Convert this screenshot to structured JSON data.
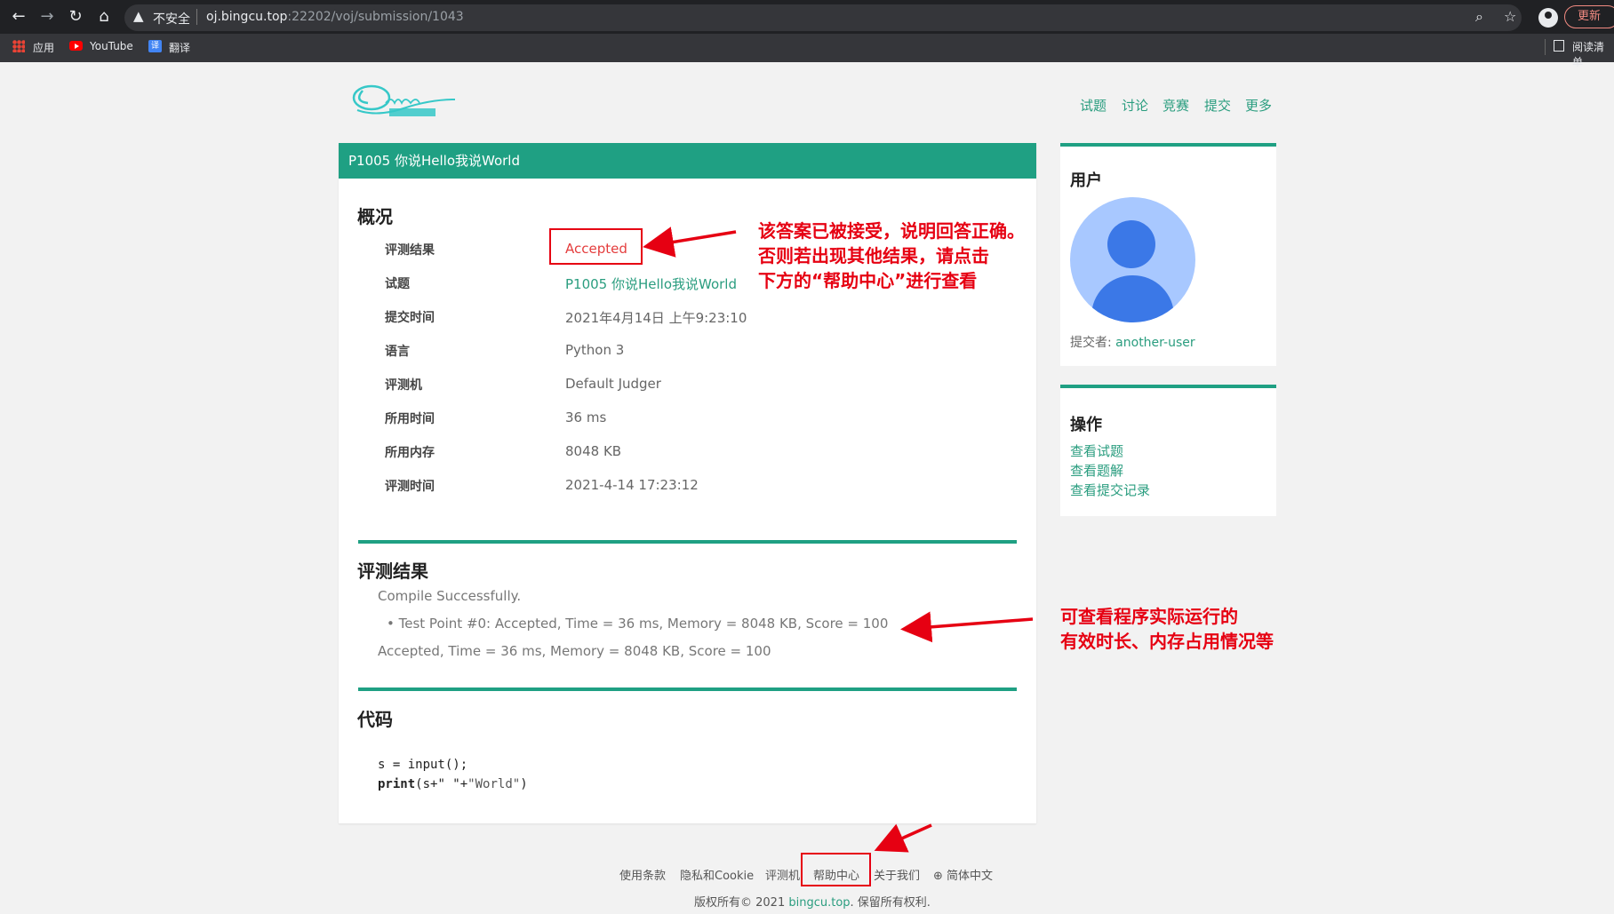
{
  "browser": {
    "insecure_label": "不安全",
    "url_host": "oj.bingcu.top",
    "url_rest": ":22202/voj/submission/1043",
    "update_label": "更新",
    "bookmarks": {
      "apps": "应用",
      "youtube": "YouTube",
      "translate": "翻译"
    },
    "reading_list": "阅读清单"
  },
  "site": {
    "nav": [
      "试题",
      "讨论",
      "竞赛",
      "提交",
      "更多"
    ]
  },
  "problem_header": "P1005 你说Hello我说World",
  "overview": {
    "title": "概况",
    "rows": [
      {
        "label": "评测结果",
        "value": "Accepted"
      },
      {
        "label": "试题",
        "value": "P1005 你说Hello我说World"
      },
      {
        "label": "提交时间",
        "value": "2021年4月14日 上午9:23:10"
      },
      {
        "label": "语言",
        "value": "Python 3"
      },
      {
        "label": "评测机",
        "value": "Default Judger"
      },
      {
        "label": "所用时间",
        "value": "36 ms"
      },
      {
        "label": "所用内存",
        "value": "8048 KB"
      },
      {
        "label": "评测时间",
        "value": "2021-4-14 17:23:12"
      }
    ]
  },
  "judge": {
    "title": "评测结果",
    "compile": "Compile Successfully.",
    "test_point": "Test Point #0: Accepted, Time = 36 ms, Memory = 8048 KB, Score = 100",
    "summary": "Accepted, Time = 36 ms, Memory = 8048 KB, Score = 100"
  },
  "code": {
    "title": "代码",
    "line1": "s = input();",
    "line2_kw": "print",
    "line2_a": "(s+\" \"+",
    "line2_str": "\"World\"",
    "line2_b": ")"
  },
  "user_card": {
    "title": "用户",
    "submitter_label": "提交者:",
    "submitter_name": "another-user"
  },
  "actions_card": {
    "title": "操作",
    "links": [
      "查看试题",
      "查看题解",
      "查看提交记录"
    ]
  },
  "annotations": {
    "accepted_note": "该答案已被接受，说明回答正确。\n否则若出现其他结果，请点击\n下方的“帮助中心”进行查看",
    "runtime_note": "可查看程序实际运行的\n有效时长、内存占用情况等"
  },
  "footer": {
    "links": [
      "使用条款",
      "隐私和Cookie",
      "评测机",
      "帮助中心",
      "关于我们",
      "简体中文"
    ],
    "copyright_prefix": "版权所有© 2021 ",
    "copyright_host": "bingcu.top",
    "copyright_suffix": ". 保留所有权利."
  },
  "colors": {
    "accent": "#1fa083",
    "link": "#2a9d7f",
    "annotation": "#e60012"
  }
}
